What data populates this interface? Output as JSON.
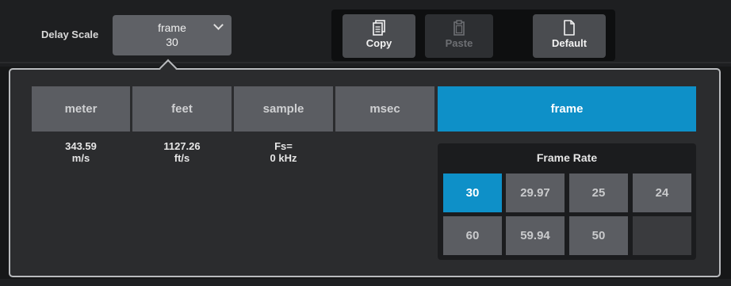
{
  "header": {
    "delay_scale_label": "Delay Scale",
    "scale_selector": {
      "unit": "frame",
      "value": "30"
    },
    "toolbar": {
      "copy_label": "Copy",
      "paste_label": "Paste",
      "default_label": "Default"
    }
  },
  "units": [
    {
      "label": "meter",
      "active": false
    },
    {
      "label": "feet",
      "active": false
    },
    {
      "label": "sample",
      "active": false
    },
    {
      "label": "msec",
      "active": false
    },
    {
      "label": "frame",
      "active": true
    }
  ],
  "info": {
    "meter": {
      "line1": "343.59",
      "line2": "m/s"
    },
    "feet": {
      "line1": "1127.26",
      "line2": "ft/s"
    },
    "sample": {
      "line1": "Fs=",
      "line2": "0 kHz"
    }
  },
  "frame_rate": {
    "title": "Frame Rate",
    "options": [
      "30",
      "29.97",
      "25",
      "24",
      "60",
      "59.94",
      "50",
      ""
    ],
    "selected": "30"
  },
  "colors": {
    "accent": "#0e90c8",
    "button": "#5b5d62",
    "panel": "#2b2c2e"
  }
}
